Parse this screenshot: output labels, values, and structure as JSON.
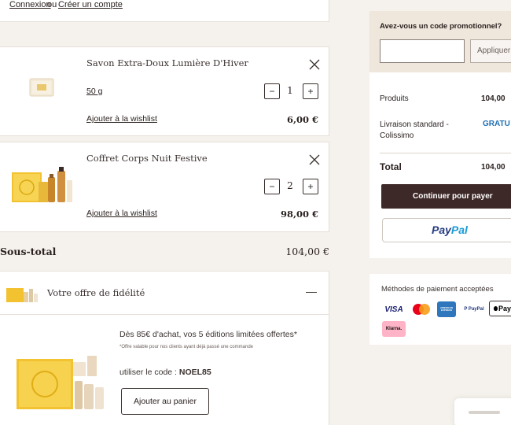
{
  "header": {
    "login": "Connexion",
    "or": "ou",
    "create_account": "Créer un compte"
  },
  "cart": {
    "items": [
      {
        "name": "Savon Extra-Doux Lumière D'Hiver",
        "variant": "50 g",
        "qty": "1",
        "wishlist": "Ajouter à la wishlist",
        "price": "6,00 €",
        "minus": "−",
        "plus": "+"
      },
      {
        "name": "Coffret Corps Nuit Festive",
        "variant": "",
        "qty": "2",
        "wishlist": "Ajouter à la wishlist",
        "price": "98,00 €",
        "minus": "−",
        "plus": "+"
      }
    ],
    "subtotal_label": "Sous-total",
    "subtotal_value": "104,00 €"
  },
  "loyalty": {
    "title": "Votre offre de fidélité",
    "toggle": "—",
    "headline": "Dès 85€ d'achat, vos 5 éditions limitées offertes*",
    "note": "*Offre valable pour nos clients ayant déjà passé une commande",
    "code_prefix": "utiliser le code : ",
    "code": "NOEL85",
    "cta": "Ajouter au panier"
  },
  "summary": {
    "promo_label": "Avez-vous un code promotionnel?",
    "promo_placeholder": "",
    "apply": "Appliquer",
    "products_label": "Produits",
    "products_value": "104,00",
    "shipping_label": "Livraison standard - Colissimo",
    "shipping_value": "GRATU",
    "total_label": "Total",
    "total_value": "104,00",
    "checkout": "Continuer pour payer",
    "paypal_pay": "Pay",
    "paypal_pal": "Pal"
  },
  "payment": {
    "label": "Méthodes de paiement acceptées",
    "visa": "VISA",
    "amex": "AMERICAN EXPRESS",
    "paypal": "P PayPal",
    "applepay": "Pay",
    "klarna": "Klarna."
  },
  "colors": {
    "accent": "#3d2a28",
    "paypal_blue": "#253b80",
    "paypal_light": "#179bd7",
    "summary_bg": "#efe6dc"
  }
}
